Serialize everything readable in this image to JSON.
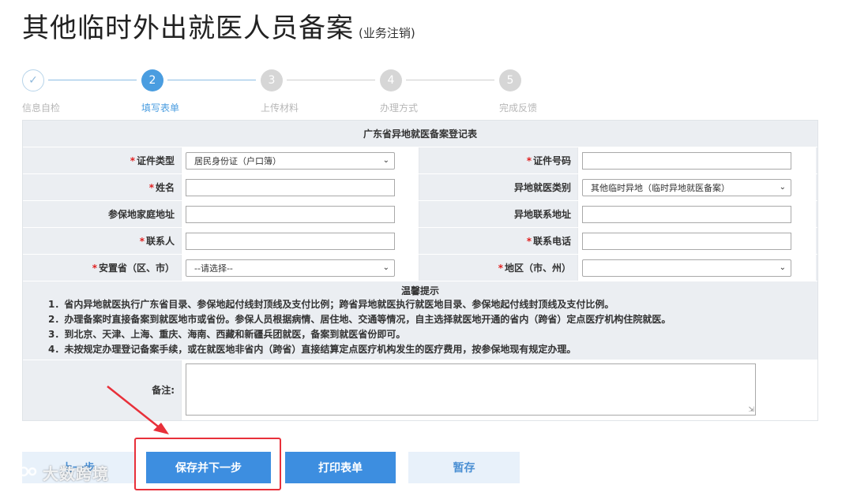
{
  "page": {
    "title": "其他临时外出就医人员备案",
    "subtitle": "(业务注销)"
  },
  "steps": [
    {
      "num": "✓",
      "label": "信息自检",
      "state": "done"
    },
    {
      "num": "2",
      "label": "填写表单",
      "state": "active"
    },
    {
      "num": "3",
      "label": "上传材料",
      "state": "todo"
    },
    {
      "num": "4",
      "label": "办理方式",
      "state": "todo"
    },
    {
      "num": "5",
      "label": "完成反馈",
      "state": "todo"
    }
  ],
  "form": {
    "title": "广东省异地就医备案登记表",
    "required_mark": "*",
    "fields": {
      "id_type_label": "证件类型",
      "id_type_value": "居民身份证（户口簿）",
      "id_number_label": "证件号码",
      "id_number_value": "",
      "name_label": "姓名",
      "name_value": "",
      "category_label": "异地就医类别",
      "category_value": "其他临时异地（临时异地就医备案）",
      "home_addr_label": "参保地家庭地址",
      "home_addr_value": "",
      "remote_addr_label": "异地联系地址",
      "remote_addr_value": "",
      "contact_label": "联系人",
      "contact_value": "",
      "phone_label": "联系电话",
      "phone_value": "",
      "province_label": "安置省（区、市）",
      "province_value": "--请选择--",
      "region_label": "地区（市、州）",
      "region_value": ""
    },
    "tips": {
      "title": "温馨提示",
      "lines": [
        "1．省内异地就医执行广东省目录、参保地起付线封顶线及支付比例；跨省异地就医执行就医地目录、参保地起付线封顶线及支付比例。",
        "2．办理备案时直接备案到就医地市或省份。参保人员根据病情、居住地、交通等情况，自主选择就医地开通的省内（跨省）定点医疗机构住院就医。",
        "3．到北京、天津、上海、重庆、海南、西藏和新疆兵团就医，备案到就医省份即可。",
        "4．未按规定办理登记备案手续，或在就医地非省内（跨省）直接结算定点医疗机构发生的医疗费用，按参保地现有规定办理。"
      ]
    },
    "note_label": "备注:",
    "note_value": ""
  },
  "buttons": {
    "prev": "上一步",
    "save_next": "保存并下一步",
    "print": "打印表单",
    "temp_save": "暂存"
  },
  "watermark": "大数跨境",
  "colors": {
    "accent": "#3d8ee0",
    "highlight": "#e8303a",
    "required": "#e02020"
  }
}
